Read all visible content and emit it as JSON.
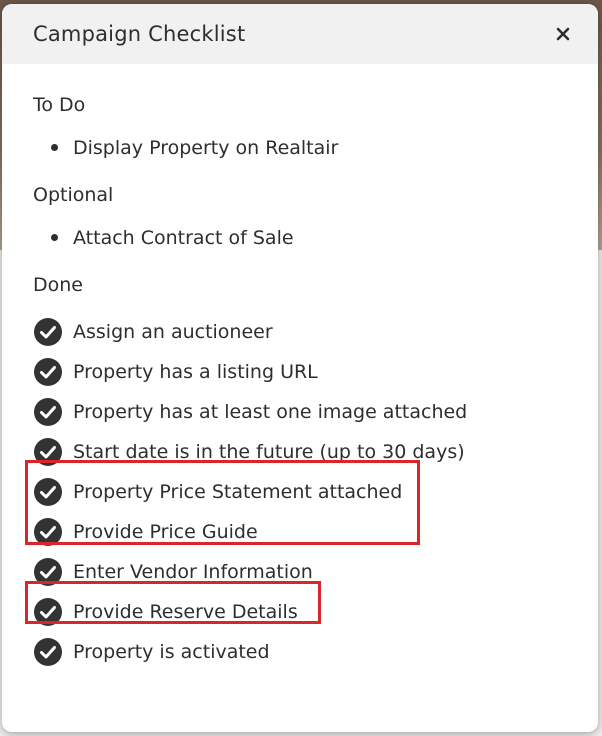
{
  "modal": {
    "title": "Campaign Checklist",
    "close_label": "×"
  },
  "sections": {
    "todo": {
      "title": "To Do",
      "items": [
        "Display Property on Realtair"
      ]
    },
    "optional": {
      "title": "Optional",
      "items": [
        "Attach Contract of Sale"
      ]
    },
    "done": {
      "title": "Done",
      "items": [
        "Assign an auctioneer",
        "Property has a listing URL",
        "Property has at least one image attached",
        "Start date is in the future (up to 30 days)",
        "Property Price Statement attached",
        "Provide Price Guide",
        "Enter Vendor Information",
        "Provide Reserve Details",
        "Property is activated"
      ]
    }
  },
  "colors": {
    "highlight": "#d9262b",
    "check_fill": "#333333"
  }
}
